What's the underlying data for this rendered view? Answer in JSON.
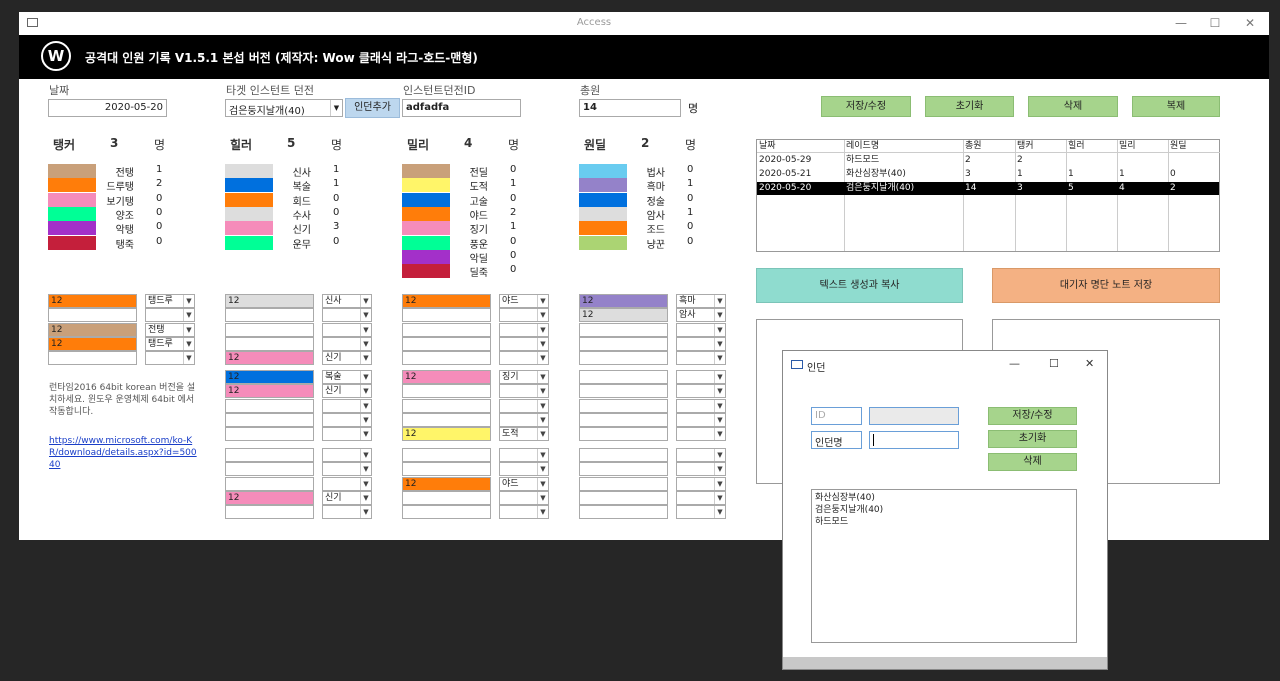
{
  "window": {
    "title": "Access",
    "min": "—",
    "max": "☐",
    "close": "✕",
    "app_icon": "form-icon"
  },
  "banner": {
    "logo": "W",
    "text": "공격대 인원 기록 V1.5.1 본섭 버전 (제작자: Wow 클래식 라그-호드-맨형)"
  },
  "fields": {
    "date_label": "날짜",
    "date_value": "2020-05-20",
    "target_label": "타겟 인스턴트 던전",
    "target_value": "검은둥지날개(40)",
    "add_person_btn": "인던추가",
    "instance_label": "인스턴트던전ID",
    "instance_value": "adfadfa",
    "total_label": "총원",
    "total_value": "14",
    "total_unit": "명"
  },
  "actions": {
    "save": "저장/수정",
    "reset": "초기화",
    "delete": "삭제",
    "copy": "복제"
  },
  "groups": [
    {
      "title": "탱커",
      "count": "3",
      "unit": "명",
      "legend": [
        {
          "name": "전탱",
          "count": "1",
          "color": "#c9a07a"
        },
        {
          "name": "드루탱",
          "count": "2",
          "color": "#ff7d0a"
        },
        {
          "name": "보기탱",
          "count": "0",
          "color": "#f58cba"
        },
        {
          "name": "양조",
          "count": "0",
          "color": "#00ff96"
        },
        {
          "name": "악탱",
          "count": "0",
          "color": "#a330c9"
        },
        {
          "name": "탱죽",
          "count": "0",
          "color": "#c41f3b"
        }
      ]
    },
    {
      "title": "힐러",
      "count": "5",
      "unit": "명",
      "legend": [
        {
          "name": "신사",
          "count": "1",
          "color": "#dddddd"
        },
        {
          "name": "복술",
          "count": "1",
          "color": "#0070de"
        },
        {
          "name": "회드",
          "count": "0",
          "color": "#ff7d0a"
        },
        {
          "name": "수사",
          "count": "0",
          "color": "#dddddd"
        },
        {
          "name": "신기",
          "count": "3",
          "color": "#f58cba"
        },
        {
          "name": "운무",
          "count": "0",
          "color": "#00ff96"
        }
      ]
    },
    {
      "title": "밀리",
      "count": "4",
      "unit": "명",
      "legend": [
        {
          "name": "전딜",
          "count": "0",
          "color": "#c9a07a"
        },
        {
          "name": "도적",
          "count": "1",
          "color": "#fff569"
        },
        {
          "name": "고술",
          "count": "0",
          "color": "#0070de"
        },
        {
          "name": "야드",
          "count": "2",
          "color": "#ff7d0a"
        },
        {
          "name": "징기",
          "count": "1",
          "color": "#f58cba"
        },
        {
          "name": "풍운",
          "count": "0",
          "color": "#00ff96"
        },
        {
          "name": "악딜",
          "count": "0",
          "color": "#a330c9"
        },
        {
          "name": "딜죽",
          "count": "0",
          "color": "#c41f3b"
        }
      ]
    },
    {
      "title": "원딜",
      "count": "2",
      "unit": "명",
      "legend": [
        {
          "name": "법사",
          "count": "0",
          "color": "#69ccf0"
        },
        {
          "name": "흑마",
          "count": "1",
          "color": "#9482c9"
        },
        {
          "name": "정술",
          "count": "0",
          "color": "#0070de"
        },
        {
          "name": "암사",
          "count": "1",
          "color": "#dddddd"
        },
        {
          "name": "조드",
          "count": "0",
          "color": "#ff7d0a"
        },
        {
          "name": "냥꾼",
          "count": "0",
          "color": "#abd473"
        }
      ]
    }
  ],
  "slots": {
    "tank": [
      [
        {
          "v": "12",
          "c": "#ff7d0a",
          "s": "탱드루"
        },
        {
          "v": "",
          "c": "",
          "s": ""
        },
        {
          "v": "12",
          "c": "#c9a07a",
          "s": "전탱"
        },
        {
          "v": "12",
          "c": "#ff7d0a",
          "s": "탱드루"
        },
        {
          "v": "",
          "c": "",
          "s": ""
        }
      ]
    ],
    "heal": [
      [
        {
          "v": "12",
          "c": "#dddddd",
          "s": "신사"
        },
        {
          "v": "",
          "c": "",
          "s": ""
        },
        {
          "v": "",
          "c": "",
          "s": ""
        },
        {
          "v": "",
          "c": "",
          "s": ""
        },
        {
          "v": "12",
          "c": "#f58cba",
          "s": "신기"
        }
      ],
      [
        {
          "v": "12",
          "c": "#0070de",
          "s": "복술"
        },
        {
          "v": "12",
          "c": "#f58cba",
          "s": "신기"
        },
        {
          "v": "",
          "c": "",
          "s": ""
        },
        {
          "v": "",
          "c": "",
          "s": ""
        },
        {
          "v": "",
          "c": "",
          "s": ""
        }
      ],
      [
        {
          "v": "",
          "c": "",
          "s": ""
        },
        {
          "v": "",
          "c": "",
          "s": ""
        },
        {
          "v": "",
          "c": "",
          "s": ""
        },
        {
          "v": "12",
          "c": "#f58cba",
          "s": "신기"
        },
        {
          "v": "",
          "c": "",
          "s": ""
        }
      ]
    ],
    "melee": [
      [
        {
          "v": "12",
          "c": "#ff7d0a",
          "s": "야드"
        },
        {
          "v": "",
          "c": "",
          "s": ""
        },
        {
          "v": "",
          "c": "",
          "s": ""
        },
        {
          "v": "",
          "c": "",
          "s": ""
        },
        {
          "v": "",
          "c": "",
          "s": ""
        }
      ],
      [
        {
          "v": "12",
          "c": "#f58cba",
          "s": "징기"
        },
        {
          "v": "",
          "c": "",
          "s": ""
        },
        {
          "v": "",
          "c": "",
          "s": ""
        },
        {
          "v": "",
          "c": "",
          "s": ""
        },
        {
          "v": "12",
          "c": "#fff569",
          "s": "도적"
        }
      ],
      [
        {
          "v": "",
          "c": "",
          "s": ""
        },
        {
          "v": "",
          "c": "",
          "s": ""
        },
        {
          "v": "12",
          "c": "#ff7d0a",
          "s": "야드"
        },
        {
          "v": "",
          "c": "",
          "s": ""
        },
        {
          "v": "",
          "c": "",
          "s": ""
        }
      ]
    ],
    "ranged": [
      [
        {
          "v": "12",
          "c": "#9482c9",
          "s": "흑마"
        },
        {
          "v": "12",
          "c": "#dddddd",
          "s": "암사"
        },
        {
          "v": "",
          "c": "",
          "s": ""
        },
        {
          "v": "",
          "c": "",
          "s": ""
        },
        {
          "v": "",
          "c": "",
          "s": ""
        }
      ],
      [
        {
          "v": "",
          "c": "",
          "s": ""
        },
        {
          "v": "",
          "c": "",
          "s": ""
        },
        {
          "v": "",
          "c": "",
          "s": ""
        },
        {
          "v": "",
          "c": "",
          "s": ""
        },
        {
          "v": "",
          "c": "",
          "s": ""
        }
      ],
      [
        {
          "v": "",
          "c": "",
          "s": ""
        },
        {
          "v": "",
          "c": "",
          "s": ""
        },
        {
          "v": "",
          "c": "",
          "s": ""
        },
        {
          "v": "",
          "c": "",
          "s": ""
        },
        {
          "v": "",
          "c": "",
          "s": ""
        }
      ]
    ]
  },
  "info": {
    "text": "런타임2016 64bit korean 버전을 설치하세요. 윈도우 운영체제 64bit 에서 작동합니다.",
    "link": "https://www.microsoft.com/ko-KR/download/details.aspx?id=50040"
  },
  "grid": {
    "columns": [
      "날짜",
      "레이드명",
      "총원",
      "탱커",
      "힐러",
      "밀리",
      "원딜"
    ],
    "rows": [
      [
        "2020-05-29",
        "하드모드",
        "2",
        "2",
        "",
        "",
        ""
      ],
      [
        "2020-05-21",
        "화산심장부(40)",
        "3",
        "1",
        "1",
        "1",
        "0"
      ],
      [
        "2020-05-20",
        "검은둥지날개(40)",
        "14",
        "3",
        "5",
        "4",
        "2"
      ]
    ],
    "selected_row": 2
  },
  "big_buttons": {
    "generate": "텍스트 생성과 복사",
    "save_waitlist": "대기자 명단 노트 저장"
  },
  "dialog": {
    "title": "인던",
    "id_placeholder": "ID",
    "name_label": "인던명",
    "save": "저장/수정",
    "reset": "초기화",
    "delete": "삭제",
    "list": [
      "화산심장부(40)",
      "검은둥지날개(40)",
      "하드모드"
    ]
  }
}
